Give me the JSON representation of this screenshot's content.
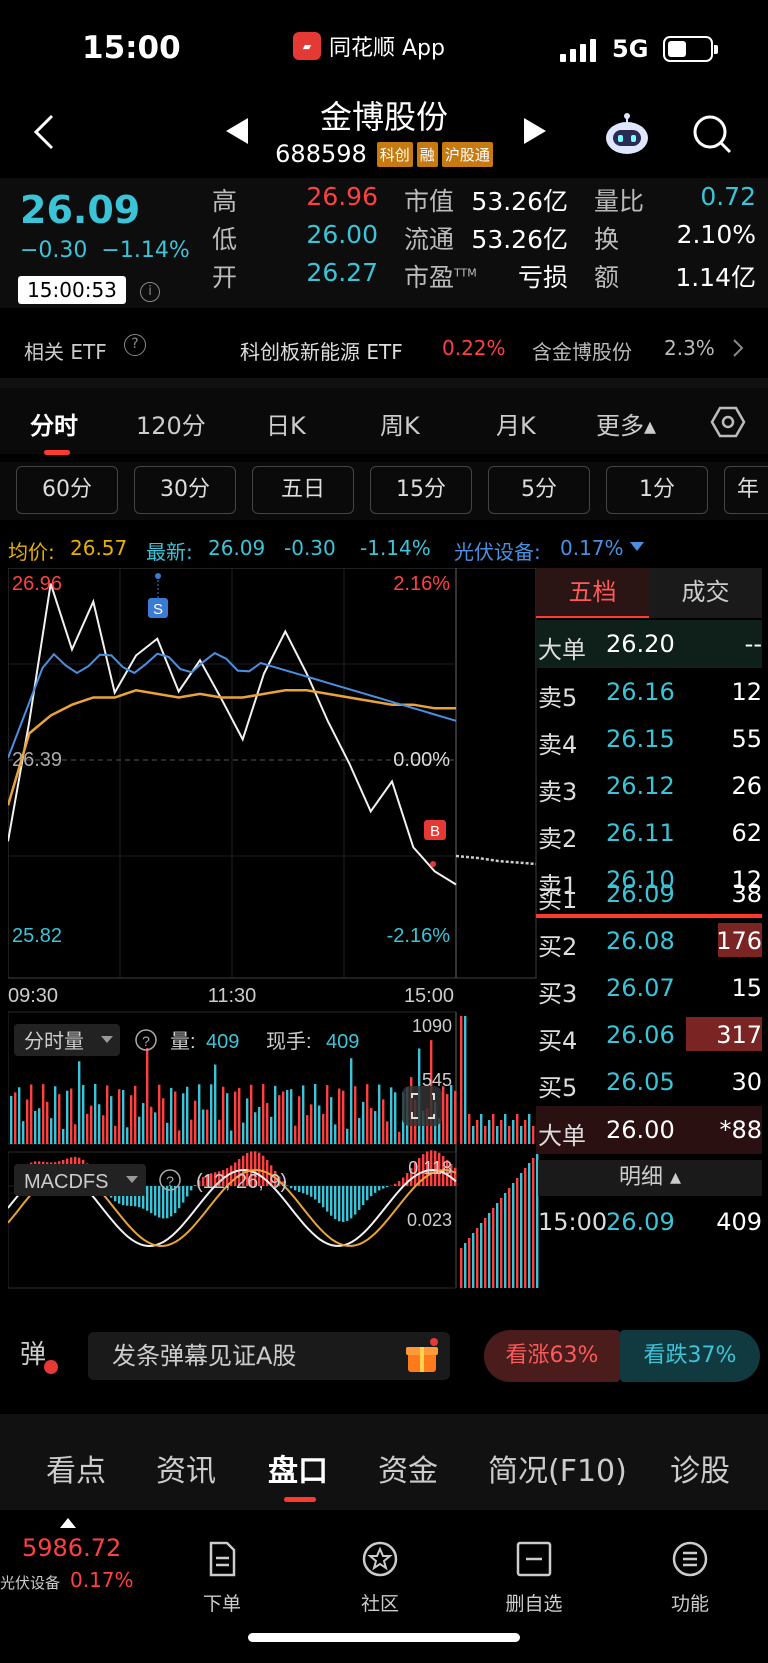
{
  "status": {
    "time": "15:00",
    "app": "同花顺 App",
    "network": "5G"
  },
  "header": {
    "title": "金博股份",
    "code": "688598",
    "tags": [
      "科创",
      "融",
      "沪股通"
    ]
  },
  "quote": {
    "price": "26.09",
    "change": "−0.30",
    "change_pct": "−1.14%",
    "time": "15:00:53",
    "fields": [
      {
        "label": "高",
        "value": "26.96",
        "color": "#ff4040"
      },
      {
        "label": "低",
        "value": "26.00",
        "color": "#3bc4d8"
      },
      {
        "label": "开",
        "value": "26.27",
        "color": "#3bc4d8"
      },
      {
        "label": "市值",
        "value": "53.26亿"
      },
      {
        "label": "流通",
        "value": "53.26亿"
      },
      {
        "label": "市盈",
        "sup": "TTM",
        "value": "亏损"
      },
      {
        "label": "量比",
        "value": "0.72",
        "color": "#3bc4d8"
      },
      {
        "label": "换",
        "value": "2.10%"
      },
      {
        "label": "额",
        "value": "1.14亿"
      }
    ]
  },
  "etf": {
    "label": "相关 ETF",
    "name": "科创板新能源 ETF",
    "pct": "0.22%",
    "holding": "含金博股份",
    "holding_pct": "2.3%"
  },
  "tabs": [
    "分时",
    "120分",
    "日K",
    "周K",
    "月K",
    "更多▴"
  ],
  "periods": [
    "60分",
    "30分",
    "五日",
    "15分",
    "5分",
    "1分",
    "年"
  ],
  "avg": {
    "avg_label": "均价:",
    "avg_value": "26.57",
    "latest_label": "最新:",
    "latest_value": "26.09",
    "change": "-0.30",
    "change_pct": "-1.14%",
    "sector_label": "光伏设备:",
    "sector_pct": "0.17%"
  },
  "chart_labels": {
    "top_price": "26.96",
    "top_pct": "2.16%",
    "mid_price": "26.39",
    "mid_pct": "0.00%",
    "bot_price": "25.82",
    "bot_pct": "-2.16%",
    "times": [
      "09:30",
      "11:30",
      "15:00"
    ],
    "marker_s": "S",
    "marker_b": "B"
  },
  "volume": {
    "label": "分时量",
    "vol_label": "量:",
    "vol": "409",
    "hand_label": "现手:",
    "hand": "409",
    "max": "1090",
    "mid": "545"
  },
  "macd": {
    "label": "MACDFS",
    "params": "(12, 26, 9)",
    "top": "0.118",
    "mid": "0.023"
  },
  "panel": {
    "tab_active": "五档",
    "tab_other": "成交",
    "big_sell": {
      "label": "大单",
      "price": "26.20",
      "vol": "--"
    },
    "asks": [
      {
        "label": "卖5",
        "price": "26.16",
        "vol": "12"
      },
      {
        "label": "卖4",
        "price": "26.15",
        "vol": "55"
      },
      {
        "label": "卖3",
        "price": "26.12",
        "vol": "26"
      },
      {
        "label": "卖2",
        "price": "26.11",
        "vol": "62"
      },
      {
        "label": "卖1",
        "price": "26.10",
        "vol": "12"
      }
    ],
    "bids": [
      {
        "label": "买1",
        "price": "26.09",
        "vol": "38"
      },
      {
        "label": "买2",
        "price": "26.08",
        "vol": "176"
      },
      {
        "label": "买3",
        "price": "26.07",
        "vol": "15"
      },
      {
        "label": "买4",
        "price": "26.06",
        "vol": "317"
      },
      {
        "label": "买5",
        "price": "26.05",
        "vol": "30"
      }
    ],
    "big_buy": {
      "label": "大单",
      "price": "26.00",
      "vol": "*88"
    },
    "detail_label": "明细 ▴",
    "last_trade": {
      "time": "15:00",
      "price": "26.09",
      "vol": "409"
    }
  },
  "danmaku": {
    "icon": "弹",
    "placeholder": "发条弹幕见证A股",
    "bull": "看涨63%",
    "bear": "看跌37%"
  },
  "bottom_tabs": [
    "看点",
    "资讯",
    "盘口",
    "资金",
    "简况(F10)",
    "诊股"
  ],
  "footer": {
    "index_value": "5986.72",
    "index_name": "光伏设备",
    "index_pct": "0.17%",
    "items": [
      "下单",
      "社区",
      "删自选",
      "功能"
    ]
  },
  "colors": {
    "up": "#ff4040",
    "down": "#3bc4d8",
    "avg_line": "#e8a33a",
    "sector_line": "#4a8fe0",
    "accent": "#ff3b30"
  },
  "chart_data": {
    "type": "line",
    "title": "",
    "x_labels": [
      "09:30",
      "11:30",
      "15:00"
    ],
    "ylim": [
      25.82,
      26.96
    ],
    "prev_close": 26.39,
    "series": [
      {
        "name": "最新",
        "values": [
          26.2,
          26.55,
          26.9,
          26.75,
          26.85,
          26.63,
          26.7,
          26.78,
          26.6,
          26.72,
          26.58,
          26.5,
          26.65,
          26.8,
          26.65,
          26.55,
          26.4,
          26.3,
          26.35,
          26.2,
          26.1,
          26.08
        ]
      },
      {
        "name": "均价",
        "values": [
          26.3,
          26.5,
          26.55,
          26.58,
          26.6,
          26.6,
          26.62,
          26.61,
          26.6,
          26.61,
          26.6,
          26.6,
          26.61,
          26.62,
          26.62,
          26.61,
          26.6,
          26.59,
          26.58,
          26.58,
          26.57,
          26.57
        ]
      }
    ]
  }
}
